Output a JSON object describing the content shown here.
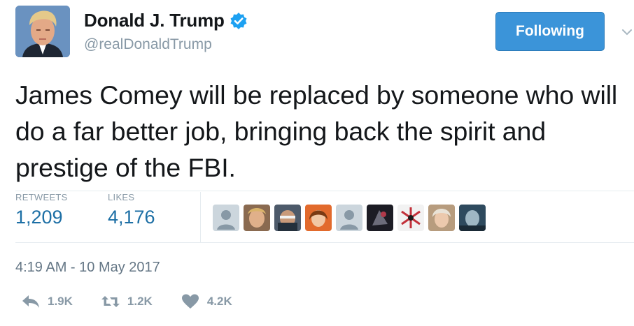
{
  "user": {
    "name": "Donald J. Trump",
    "handle": "@realDonaldTrump",
    "follow_label": "Following"
  },
  "tweet": {
    "text": "James Comey will be replaced by someone who will do a far better job, bringing back the spirit and prestige of the FBI.",
    "timestamp": "4:19 AM - 10 May 2017"
  },
  "stats": {
    "retweets_label": "RETWEETS",
    "retweets_value": "1,209",
    "likes_label": "LIKES",
    "likes_value": "4,176"
  },
  "actions": {
    "reply_count": "1.9K",
    "retweet_count": "1.2K",
    "like_count": "4.2K"
  },
  "colors": {
    "accent": "#3b94d9",
    "stat_value": "#1d6fa5",
    "muted": "#8899a6",
    "verified": "#1da1f2"
  },
  "icons": {
    "verified": "verified-badge-icon",
    "caret": "chevron-down-icon",
    "reply": "reply-icon",
    "retweet": "retweet-icon",
    "like": "heart-icon"
  }
}
